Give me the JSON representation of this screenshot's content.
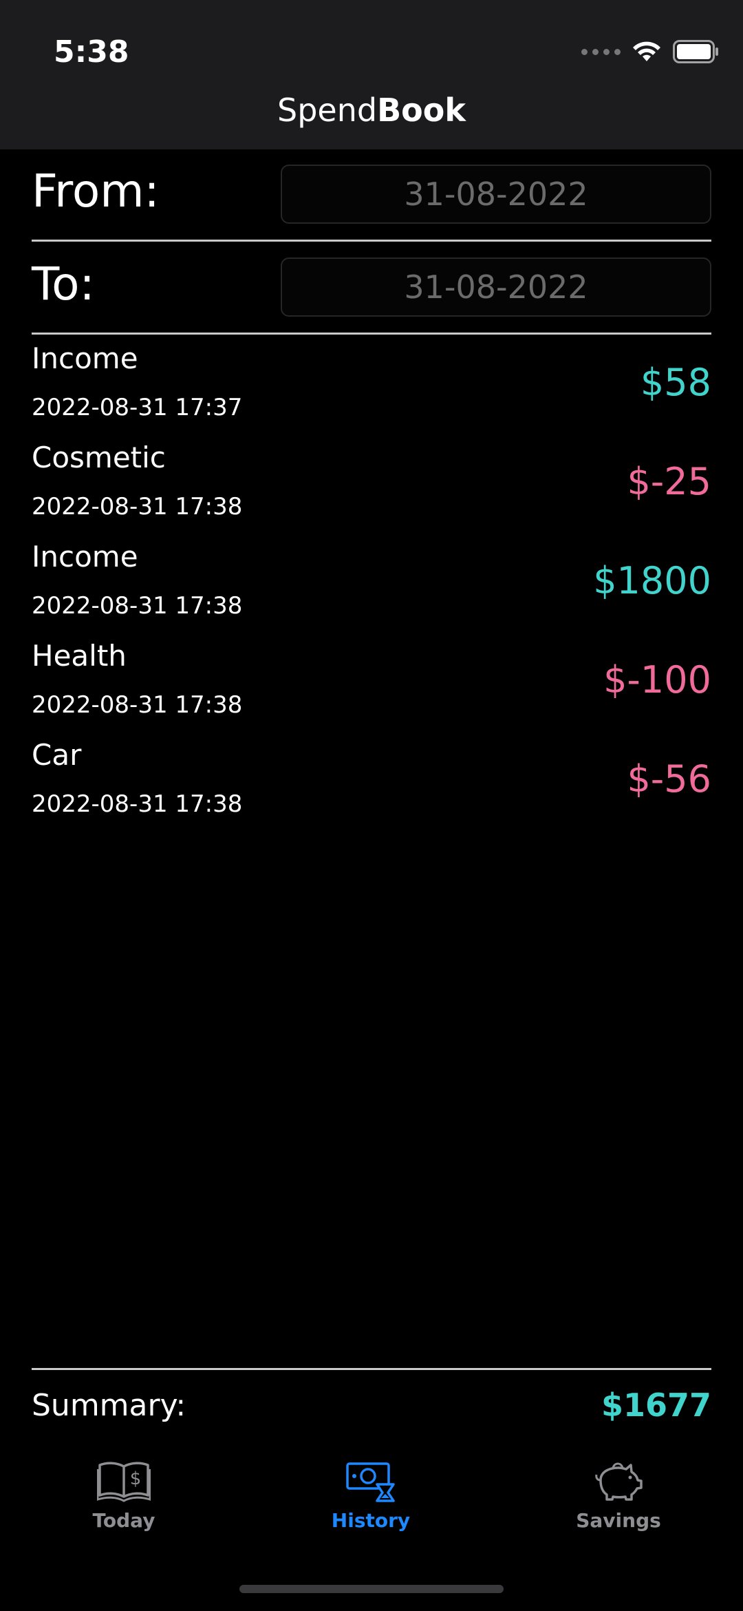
{
  "status": {
    "time": "5:38"
  },
  "header": {
    "title_light": "Spend",
    "title_bold": "Book"
  },
  "filter": {
    "from_label": "From:",
    "from_value": "31-08-2022",
    "to_label": "To:",
    "to_value": "31-08-2022"
  },
  "transactions": [
    {
      "category": "Income",
      "datetime": "2022-08-31 17:37",
      "amount": "$58"
    },
    {
      "category": "Cosmetic",
      "datetime": "2022-08-31 17:38",
      "amount": "$-25"
    },
    {
      "category": "Income",
      "datetime": "2022-08-31 17:38",
      "amount": "$1800"
    },
    {
      "category": "Health",
      "datetime": "2022-08-31 17:38",
      "amount": "$-100"
    },
    {
      "category": "Car",
      "datetime": "2022-08-31 17:38",
      "amount": "$-56"
    }
  ],
  "summary": {
    "label": "Summary:",
    "value": "$1677"
  },
  "tabs": [
    {
      "label": "Today",
      "icon": "book-dollar-icon"
    },
    {
      "label": "History",
      "icon": "money-hourglass-icon",
      "active": true
    },
    {
      "label": "Savings",
      "icon": "piggy-bank-icon"
    }
  ],
  "colors": {
    "income": "#40d4cd",
    "expense": "#f06b9a",
    "active_tab": "#1e88ff",
    "inactive_tab": "#8e8e93"
  }
}
